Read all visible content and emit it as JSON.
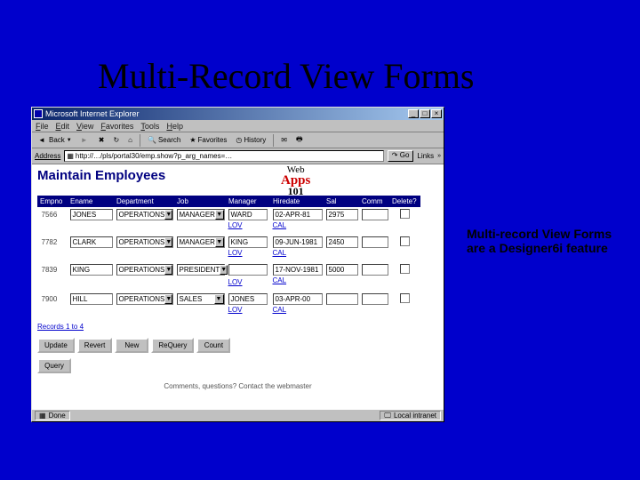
{
  "slide": {
    "title": "Multi-Record View Forms",
    "caption": "Multi-record View Forms are a Designer6i feature"
  },
  "browser": {
    "title": "Microsoft Internet Explorer",
    "menu": [
      "File",
      "Edit",
      "View",
      "Favorites",
      "Tools",
      "Help"
    ],
    "toolbar": {
      "back": "Back",
      "search": "Search",
      "favorites": "Favorites",
      "history": "History"
    },
    "address_label": "Address",
    "address_value": "http://…/pls/portal30/emp.show?p_arg_names=…",
    "go": "Go",
    "links": "Links"
  },
  "page": {
    "heading": "Maintain Employees",
    "logo": {
      "line1": "Web",
      "line2": "Apps",
      "line3": "101"
    },
    "columns": [
      "Empno",
      "Ename",
      "Department",
      "Job",
      "Manager",
      "Hiredate",
      "Sal",
      "Comm",
      "Delete?"
    ],
    "lov_label": "LOV",
    "rows": [
      {
        "empno": "7566",
        "ename": "JONES",
        "dept": "OPERATIONS",
        "job": "MANAGER",
        "mgr": "WARD",
        "hiredate": "02-APR-81",
        "sal": "2975",
        "comm": ""
      },
      {
        "empno": "7782",
        "ename": "CLARK",
        "dept": "OPERATIONS",
        "job": "MANAGER",
        "mgr": "KING",
        "hiredate": "09-JUN-1981",
        "sal": "2450",
        "comm": ""
      },
      {
        "empno": "7839",
        "ename": "KING",
        "dept": "OPERATIONS",
        "job": "PRESIDENT",
        "mgr": "",
        "hiredate": "17-NOV-1981",
        "sal": "5000",
        "comm": ""
      },
      {
        "empno": "7900",
        "ename": "HILL",
        "dept": "OPERATIONS",
        "job": "SALES",
        "mgr": "JONES",
        "hiredate": "03-APR-00",
        "sal": "",
        "comm": ""
      }
    ],
    "record_count": "Records 1 to 4",
    "buttons": {
      "update": "Update",
      "revert": "Revert",
      "new": "New",
      "requery": "ReQuery",
      "count": "Count",
      "query": "Query"
    },
    "footer": "Comments, questions? Contact the webmaster"
  },
  "statusbar": {
    "done": "Done",
    "zone": "Local intranet"
  }
}
